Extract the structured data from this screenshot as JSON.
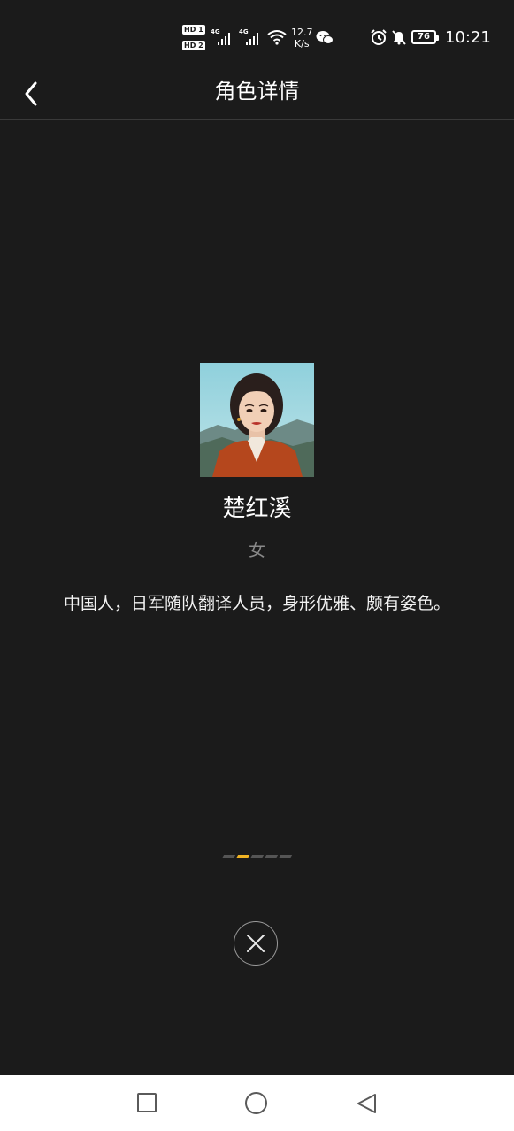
{
  "status_bar": {
    "hd1": "HD 1",
    "hd2": "HD 2",
    "signal1": "4G",
    "signal2": "4G",
    "net_speed_value": "12.7",
    "net_speed_unit": "K/s",
    "battery": "76",
    "time": "10:21"
  },
  "header": {
    "title": "角色详情"
  },
  "character": {
    "name": "楚红溪",
    "gender": "女",
    "description": "中国人，日军随队翻译人员，身形优雅、颇有姿色。"
  },
  "pager": {
    "total": 5,
    "active_index": 1,
    "active_color": "#f0b323"
  },
  "icons": {
    "back": "chevron-left-icon",
    "close": "close-icon",
    "nav_recent": "square-icon",
    "nav_home": "circle-icon",
    "nav_back": "triangle-back-icon"
  }
}
